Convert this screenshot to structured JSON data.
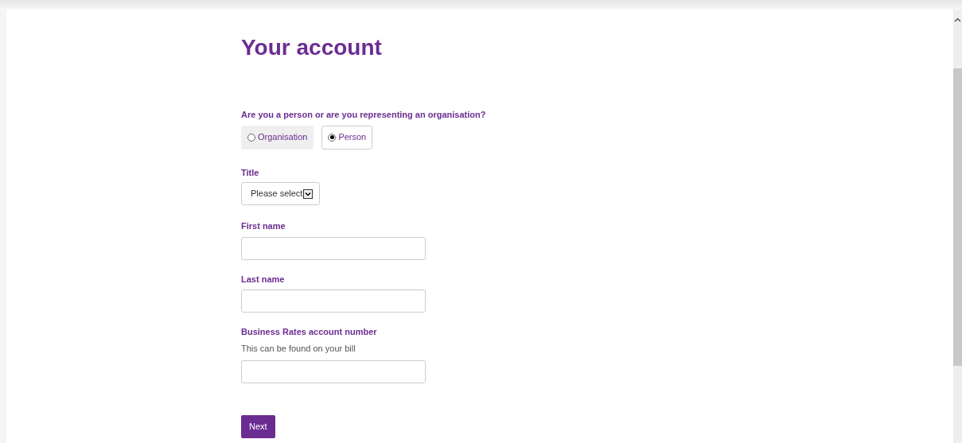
{
  "heading": "Your account",
  "account_type": {
    "label": "Are you a person or are you representing an organisation?",
    "options": [
      {
        "label": "Organisation",
        "selected": false
      },
      {
        "label": "Person",
        "selected": true
      }
    ]
  },
  "title_field": {
    "label": "Title",
    "value": "Please select"
  },
  "fields": [
    {
      "label": "First name"
    },
    {
      "label": "Last name"
    },
    {
      "label": "Business Rates account number",
      "hint": "This can be found on your bill"
    }
  ],
  "next_button": "Next"
}
